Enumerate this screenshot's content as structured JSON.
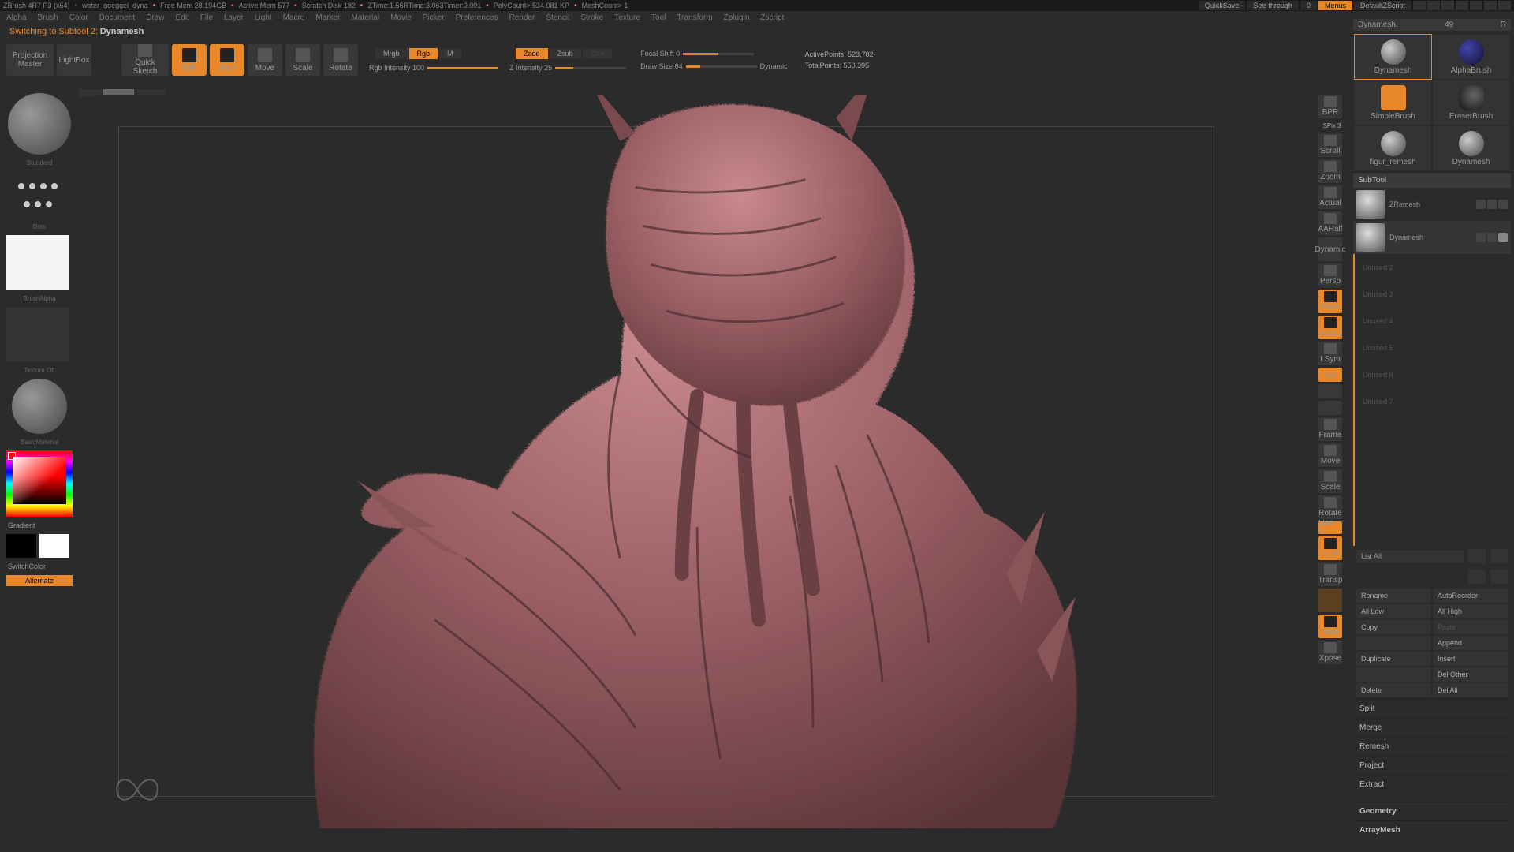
{
  "titlebar": {
    "app": "ZBrush 4R7 P3 (x64)",
    "doc": "water_goeggel_dyna",
    "freemem": "Free Mem 28.194GB",
    "activemem": "Active Mem 577",
    "scratch": "Scratch Disk 182",
    "ztime": "ZTime:1.56",
    "rtime": "RTime:3.063",
    "timer": "Timer:0.001",
    "polycount": "PolyCount> 534.081 KP",
    "meshcount": "MeshCount> 1",
    "quicksave": "QuickSave",
    "seethrough": "See-through",
    "seethrough_val": "0",
    "menus": "Menus",
    "defaultz": "DefaultZScript"
  },
  "toolheader": {
    "name": "Dynamesh.",
    "num": "49",
    "r": "R"
  },
  "menubar": [
    "Alpha",
    "Brush",
    "Color",
    "Document",
    "Draw",
    "Edit",
    "File",
    "Layer",
    "Light",
    "Macro",
    "Marker",
    "Material",
    "Movie",
    "Picker",
    "Preferences",
    "Render",
    "Stencil",
    "Stroke",
    "Texture",
    "Tool",
    "Transform",
    "Zplugin",
    "Zscript"
  ],
  "statusline": {
    "text": "Switching to Subtool 2:",
    "val": "Dynamesh"
  },
  "topbar": {
    "projection": "Projection\nMaster",
    "lightbox": "LightBox",
    "quicksketch": "Quick\nSketch",
    "edit": "Edit",
    "draw": "Draw",
    "move": "Move",
    "scale": "Scale",
    "rotate": "Rotate",
    "mrgb": "Mrgb",
    "rgb": "Rgb",
    "m": "M",
    "rgb_int": "Rgb Intensity 100",
    "zadd": "Zadd",
    "zsub": "Zsub",
    "zcut": "Zcut",
    "z_int": "Z Intensity 25",
    "focal": "Focal Shift 0",
    "drawsize": "Draw Size 64",
    "dynamic": "Dynamic",
    "active": "ActivePoints: 523,782",
    "total": "TotalPoints: 550,395"
  },
  "leftside": {
    "brush": "Standard",
    "dots": "Dots",
    "alpha": "BrushAlpha",
    "texture": "Texture Off",
    "material": "BasicMaterial",
    "gradient": "Gradient",
    "switch": "SwitchColor",
    "alternate": "Alternate"
  },
  "rightvert": {
    "spix": "SPix 3",
    "items": [
      "BPR",
      "Scroll",
      "Zoom",
      "Actual",
      "AAHalf",
      "Dynamic",
      "Persp",
      "Floor",
      "Local",
      "LSym",
      "Xyz",
      "",
      "",
      "Frame",
      "Move",
      "Scale",
      "Rotate",
      "Line Fill",
      "PolyF",
      "Transp",
      "",
      "Solo",
      "Xpose"
    ]
  },
  "brushes": [
    {
      "name": "Dynamesh",
      "sel": true
    },
    {
      "name": "AlphaBrush"
    },
    {
      "name": "SimpleBrush"
    },
    {
      "name": "EraserBrush"
    },
    {
      "name": "figur_remesh"
    },
    {
      "name": "Dynamesh"
    }
  ],
  "subtool": {
    "header": "SubTool",
    "items": [
      {
        "name": "ZRemesh"
      },
      {
        "name": "Dynamesh",
        "sel": true
      }
    ],
    "unused": [
      "Unused 2",
      "Unused 3",
      "Unused 4",
      "Unused 5",
      "Unused 6",
      "Unused 7"
    ],
    "listall": "List All",
    "buttons": [
      [
        "Rename",
        "AutoReorder"
      ],
      [
        "All Low",
        "All High"
      ],
      [
        "Copy",
        "Paste"
      ],
      [
        "",
        "Append"
      ],
      [
        "Duplicate",
        "Insert"
      ],
      [
        "",
        "Del Other"
      ],
      [
        "Delete",
        "Del All"
      ]
    ],
    "sections": [
      "Split",
      "Merge",
      "Remesh",
      "Project",
      "Extract"
    ],
    "footer": [
      "Geometry",
      "ArrayMesh"
    ]
  }
}
